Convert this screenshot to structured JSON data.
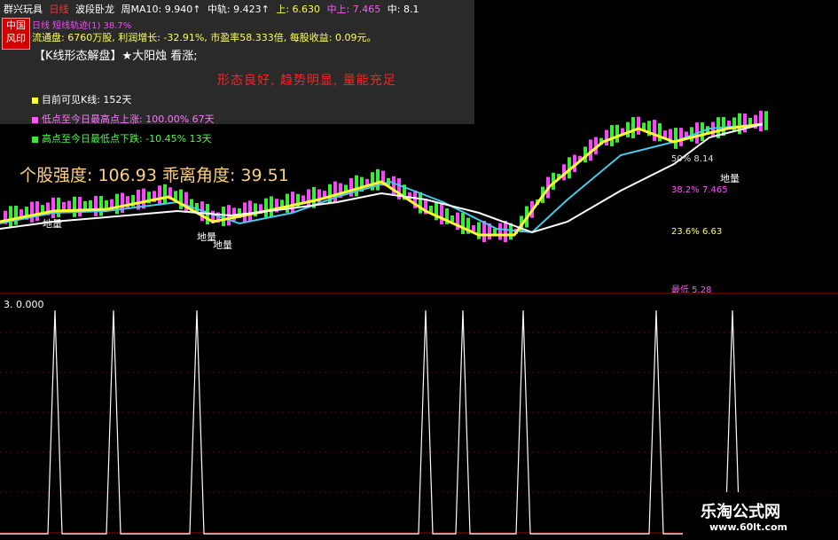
{
  "topbar": {
    "stock": "群兴玩具",
    "period": "日线",
    "indicator": "波段卧龙",
    "ma10": "周MA10: 9.940↑",
    "mid_track": "中轨: 9.423↑",
    "upper": "上: 6.630",
    "mid_upper": "中上: 7.465",
    "mid": "中: 8.1"
  },
  "seal": {
    "line1": "中国",
    "line2": "风印"
  },
  "magenta_line": "日线 短线轨迹(1) 38.7%",
  "finance_line": "流通盘: 6760万股, 利润增长: -32.91%, 市盈率58.333倍, 每股收益: 0.09元。",
  "kline_line": "【K线形态解盘】★大阳烛 看涨;",
  "pattern_line": "形态良好, 趋势明显, 量能充足",
  "legend": [
    {
      "text": "目前可见K线: 152天",
      "color": "#ffff33"
    },
    {
      "text": "低点至今日最高点上涨: 100.00% 67天",
      "color": "#ff55ff"
    },
    {
      "text": "高点至今日最低点下跌: -10.45% 13天",
      "color": "#33ee33"
    }
  ],
  "strength_line": "个股强度: 106.93 乖离角度: 39.51",
  "fib_levels": [
    {
      "label": "50%  8.14",
      "color": "#dddddd"
    },
    {
      "label": "38.2%  7.465",
      "color": "#ff55ff"
    },
    {
      "label": "23.6%  6.63",
      "color": "#ffff55"
    },
    {
      "label": "最低  5.28",
      "color": "#ff55ff"
    }
  ],
  "diwei_labels": [
    "地量",
    "地量",
    "地量",
    "地量"
  ],
  "oscillator": {
    "label": "3. 0.000",
    "spikes_at": [
      62,
      128,
      222,
      480,
      522,
      590,
      740,
      826
    ],
    "max_value": 3.0
  },
  "watermark": {
    "title": "乐淘公式网",
    "url": "www.60lt.com"
  },
  "colors": {
    "up_candle": "#ff44ff",
    "down_candle": "#33ee33",
    "yellow_line": "#ffff33",
    "cyan_line": "#44ccee",
    "white_line": "#ffffff",
    "grid": "#8b0000"
  }
}
